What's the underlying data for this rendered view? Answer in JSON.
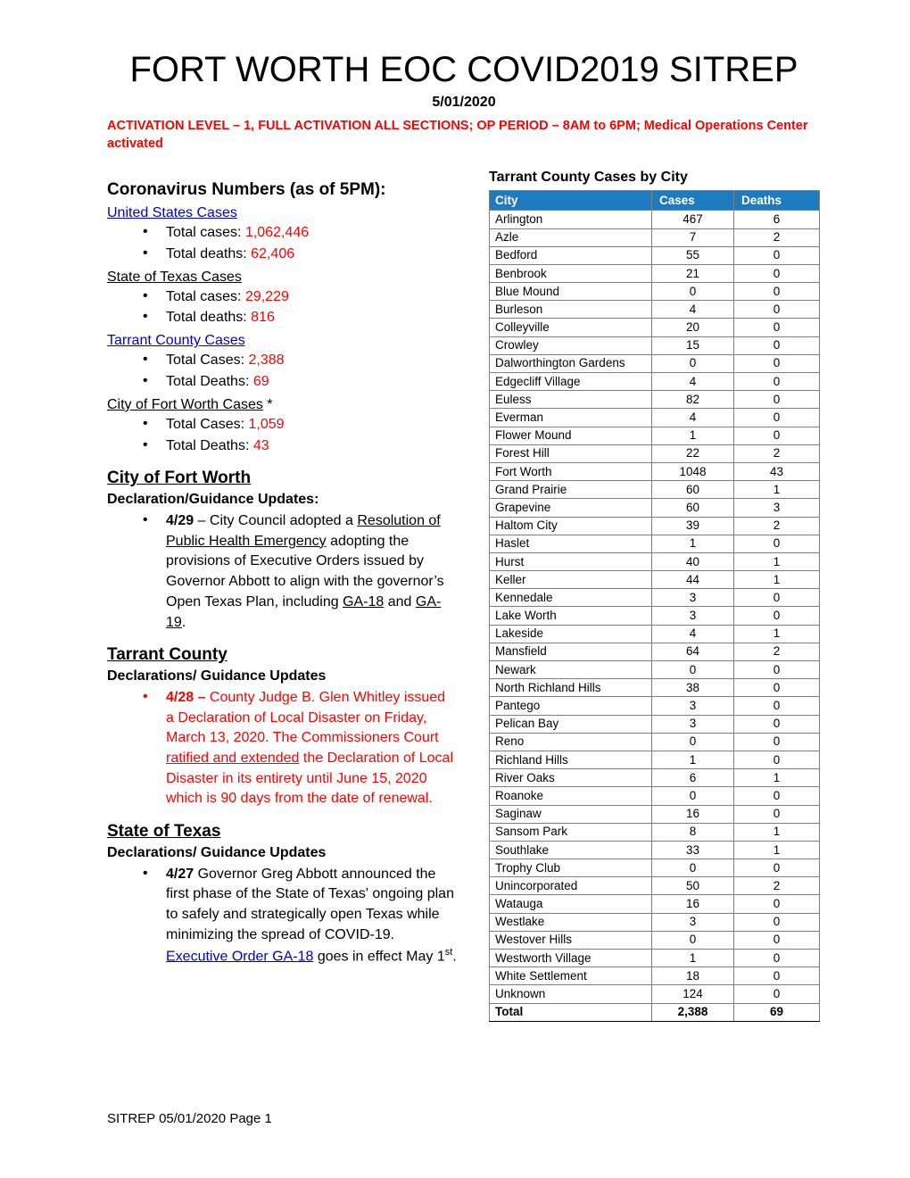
{
  "header": {
    "title": "FORT WORTH EOC COVID2019 SITREP",
    "date": "5/01/2020",
    "activation": "ACTIVATION LEVEL – 1, FULL ACTIVATION ALL SECTIONS; OP PERIOD – 8AM to 6PM; Medical Operations Center activated"
  },
  "left": {
    "numbers_heading": "Coronavirus Numbers (as of 5PM):",
    "groups": [
      {
        "label": "United States Cases",
        "style": "link",
        "items": [
          {
            "label": "Total cases: ",
            "value": "1,062,446"
          },
          {
            "label": "Total deaths: ",
            "value": "62,406"
          }
        ]
      },
      {
        "label": "State of Texas Cases",
        "style": "plain",
        "items": [
          {
            "label": "Total cases: ",
            "value": "29,229"
          },
          {
            "label": "Total deaths: ",
            "value": "816"
          }
        ]
      },
      {
        "label": "Tarrant County Cases",
        "style": "link",
        "items": [
          {
            "label": "Total Cases: ",
            "value": "2,388"
          },
          {
            "label": "Total Deaths: ",
            "value": "69"
          }
        ]
      },
      {
        "label": "City of Fort Worth Cases",
        "label_suffix": " *",
        "style": "plain",
        "items": [
          {
            "label": "Total Cases: ",
            "value": "1,059"
          },
          {
            "label": "Total Deaths: ",
            "value": "43"
          }
        ]
      }
    ],
    "fw": {
      "heading": "City of Fort Worth",
      "subheading": "Declaration/Guidance Updates:",
      "bullet_date": "4/29",
      "bullet_p1": " – City Council adopted a ",
      "bullet_link": "Resolution of Public Health Emergency",
      "bullet_p2": " adopting the provisions of Executive Orders issued by Governor Abbott to align with the governor’s Open Texas Plan, including ",
      "bullet_ga18": "GA-18",
      "bullet_p3": " and ",
      "bullet_ga19": "GA-19",
      "bullet_p4": "."
    },
    "county": {
      "heading": "Tarrant County",
      "subheading": "Declarations/ Guidance Updates",
      "bullet_date": "4/28 –",
      "bullet_p1": " County Judge B. Glen Whitley issued a Declaration of Local Disaster on Friday, March 13, 2020. The Commissioners Court ",
      "bullet_u1": "ratified and extended",
      "bullet_p2": " the Declaration of Local Disaster in its entirety until June 15, 2020 which is 90 days from the date of renewal."
    },
    "state": {
      "heading": "State of Texas",
      "subheading": "Declarations/ Guidance Updates",
      "bullet_date": "4/27",
      "bullet_p1": " Governor Greg Abbott announced the first phase of the State of Texas' ongoing plan to safely and strategically open Texas while minimizing the spread of COVID-19. ",
      "bullet_link": "Executive Order GA-18",
      "bullet_p2": " goes in effect May 1",
      "bullet_sup": "st",
      "bullet_p3": "."
    }
  },
  "table": {
    "title": "Tarrant County Cases by City",
    "columns": [
      "City",
      "Cases",
      "Deaths"
    ],
    "rows": [
      {
        "city": "Arlington",
        "cases": "467",
        "deaths": "6",
        "cases_red": true,
        "deaths_red": false
      },
      {
        "city": "Azle",
        "cases": "7",
        "deaths": "2",
        "cases_red": false,
        "deaths_red": false
      },
      {
        "city": "Bedford",
        "cases": "55",
        "deaths": "0",
        "cases_red": true,
        "deaths_red": false
      },
      {
        "city": "Benbrook",
        "cases": "21",
        "deaths": "0",
        "cases_red": false,
        "deaths_red": false
      },
      {
        "city": "Blue Mound",
        "cases": "0",
        "deaths": "0",
        "cases_red": false,
        "deaths_red": false
      },
      {
        "city": "Burleson",
        "cases": "4",
        "deaths": "0",
        "cases_red": false,
        "deaths_red": false
      },
      {
        "city": "Colleyville",
        "cases": "20",
        "deaths": "0",
        "cases_red": false,
        "deaths_red": false
      },
      {
        "city": "Crowley",
        "cases": "15",
        "deaths": "0",
        "cases_red": false,
        "deaths_red": false
      },
      {
        "city": "Dalworthington Gardens",
        "cases": "0",
        "deaths": "0",
        "cases_red": false,
        "deaths_red": false
      },
      {
        "city": "Edgecliff Village",
        "cases": "4",
        "deaths": "0",
        "cases_red": false,
        "deaths_red": false
      },
      {
        "city": "Euless",
        "cases": "82",
        "deaths": "0",
        "cases_red": true,
        "deaths_red": false
      },
      {
        "city": "Everman",
        "cases": "4",
        "deaths": "0",
        "cases_red": true,
        "deaths_red": false
      },
      {
        "city": "Flower Mound",
        "cases": "1",
        "deaths": "0",
        "cases_red": false,
        "deaths_red": false
      },
      {
        "city": "Forest Hill",
        "cases": "22",
        "deaths": "2",
        "cases_red": true,
        "deaths_red": false
      },
      {
        "city": "Fort Worth",
        "cases": "1048",
        "deaths": "43",
        "cases_red": true,
        "deaths_red": true
      },
      {
        "city": "Grand Prairie",
        "cases": "60",
        "deaths": "1",
        "cases_red": true,
        "deaths_red": false
      },
      {
        "city": "Grapevine",
        "cases": "60",
        "deaths": "3",
        "cases_red": false,
        "deaths_red": false
      },
      {
        "city": "Haltom City",
        "cases": "39",
        "deaths": "2",
        "cases_red": true,
        "deaths_red": false
      },
      {
        "city": "Haslet",
        "cases": "1",
        "deaths": "0",
        "cases_red": false,
        "deaths_red": false
      },
      {
        "city": "Hurst",
        "cases": "40",
        "deaths": "1",
        "cases_red": true,
        "deaths_red": false
      },
      {
        "city": "Keller",
        "cases": "44",
        "deaths": "1",
        "cases_red": true,
        "deaths_red": false
      },
      {
        "city": "Kennedale",
        "cases": "3",
        "deaths": "0",
        "cases_red": false,
        "deaths_red": false
      },
      {
        "city": "Lake Worth",
        "cases": "3",
        "deaths": "0",
        "cases_red": false,
        "deaths_red": false
      },
      {
        "city": "Lakeside",
        "cases": "4",
        "deaths": "1",
        "cases_red": true,
        "deaths_red": false
      },
      {
        "city": "Mansfield",
        "cases": "64",
        "deaths": "2",
        "cases_red": true,
        "deaths_red": false
      },
      {
        "city": "Newark",
        "cases": "0",
        "deaths": "0",
        "cases_red": false,
        "deaths_red": false
      },
      {
        "city": "North Richland Hills",
        "cases": "38",
        "deaths": "0",
        "cases_red": false,
        "deaths_red": false
      },
      {
        "city": "Pantego",
        "cases": "3",
        "deaths": "0",
        "cases_red": false,
        "deaths_red": false
      },
      {
        "city": "Pelican Bay",
        "cases": "3",
        "deaths": "0",
        "cases_red": false,
        "deaths_red": false
      },
      {
        "city": "Reno",
        "cases": "0",
        "deaths": "0",
        "cases_red": false,
        "deaths_red": false
      },
      {
        "city": "Richland Hills",
        "cases": "1",
        "deaths": "0",
        "cases_red": false,
        "deaths_red": false
      },
      {
        "city": "River Oaks",
        "cases": "6",
        "deaths": "1",
        "cases_red": false,
        "deaths_red": false
      },
      {
        "city": "Roanoke",
        "cases": "0",
        "deaths": "0",
        "cases_red": false,
        "deaths_red": false
      },
      {
        "city": "Saginaw",
        "cases": "16",
        "deaths": "0",
        "cases_red": true,
        "deaths_red": false
      },
      {
        "city": "Sansom Park",
        "cases": "8",
        "deaths": "1",
        "cases_red": false,
        "deaths_red": false
      },
      {
        "city": "Southlake",
        "cases": "33",
        "deaths": "1",
        "cases_red": false,
        "deaths_red": false
      },
      {
        "city": "Trophy Club",
        "cases": "0",
        "deaths": "0",
        "cases_red": false,
        "deaths_red": false
      },
      {
        "city": "Unincorporated",
        "cases": "50",
        "deaths": "2",
        "cases_red": true,
        "deaths_red": false
      },
      {
        "city": "Watauga",
        "cases": "16",
        "deaths": "0",
        "cases_red": true,
        "deaths_red": false
      },
      {
        "city": "Westlake",
        "cases": "3",
        "deaths": "0",
        "cases_red": false,
        "deaths_red": false
      },
      {
        "city": "Westover Hills",
        "cases": "0",
        "deaths": "0",
        "cases_red": false,
        "deaths_red": false
      },
      {
        "city": "Westworth Village",
        "cases": "1",
        "deaths": "0",
        "cases_red": false,
        "deaths_red": false
      },
      {
        "city": "White Settlement",
        "cases": "18",
        "deaths": "0",
        "cases_red": true,
        "deaths_red": false
      },
      {
        "city": "Unknown",
        "cases": "124",
        "deaths": "0",
        "cases_red": true,
        "deaths_red": false
      }
    ],
    "total": {
      "city": "Total",
      "cases": "2,388",
      "deaths": "69",
      "cases_red": true,
      "deaths_red": true
    }
  },
  "footer": {
    "text": "SITREP 05/01/2020 Page 1"
  },
  "colors": {
    "header_blue": "#1F7BC1",
    "alert_red": "#FF0000",
    "link_blue": "#0000CC"
  }
}
